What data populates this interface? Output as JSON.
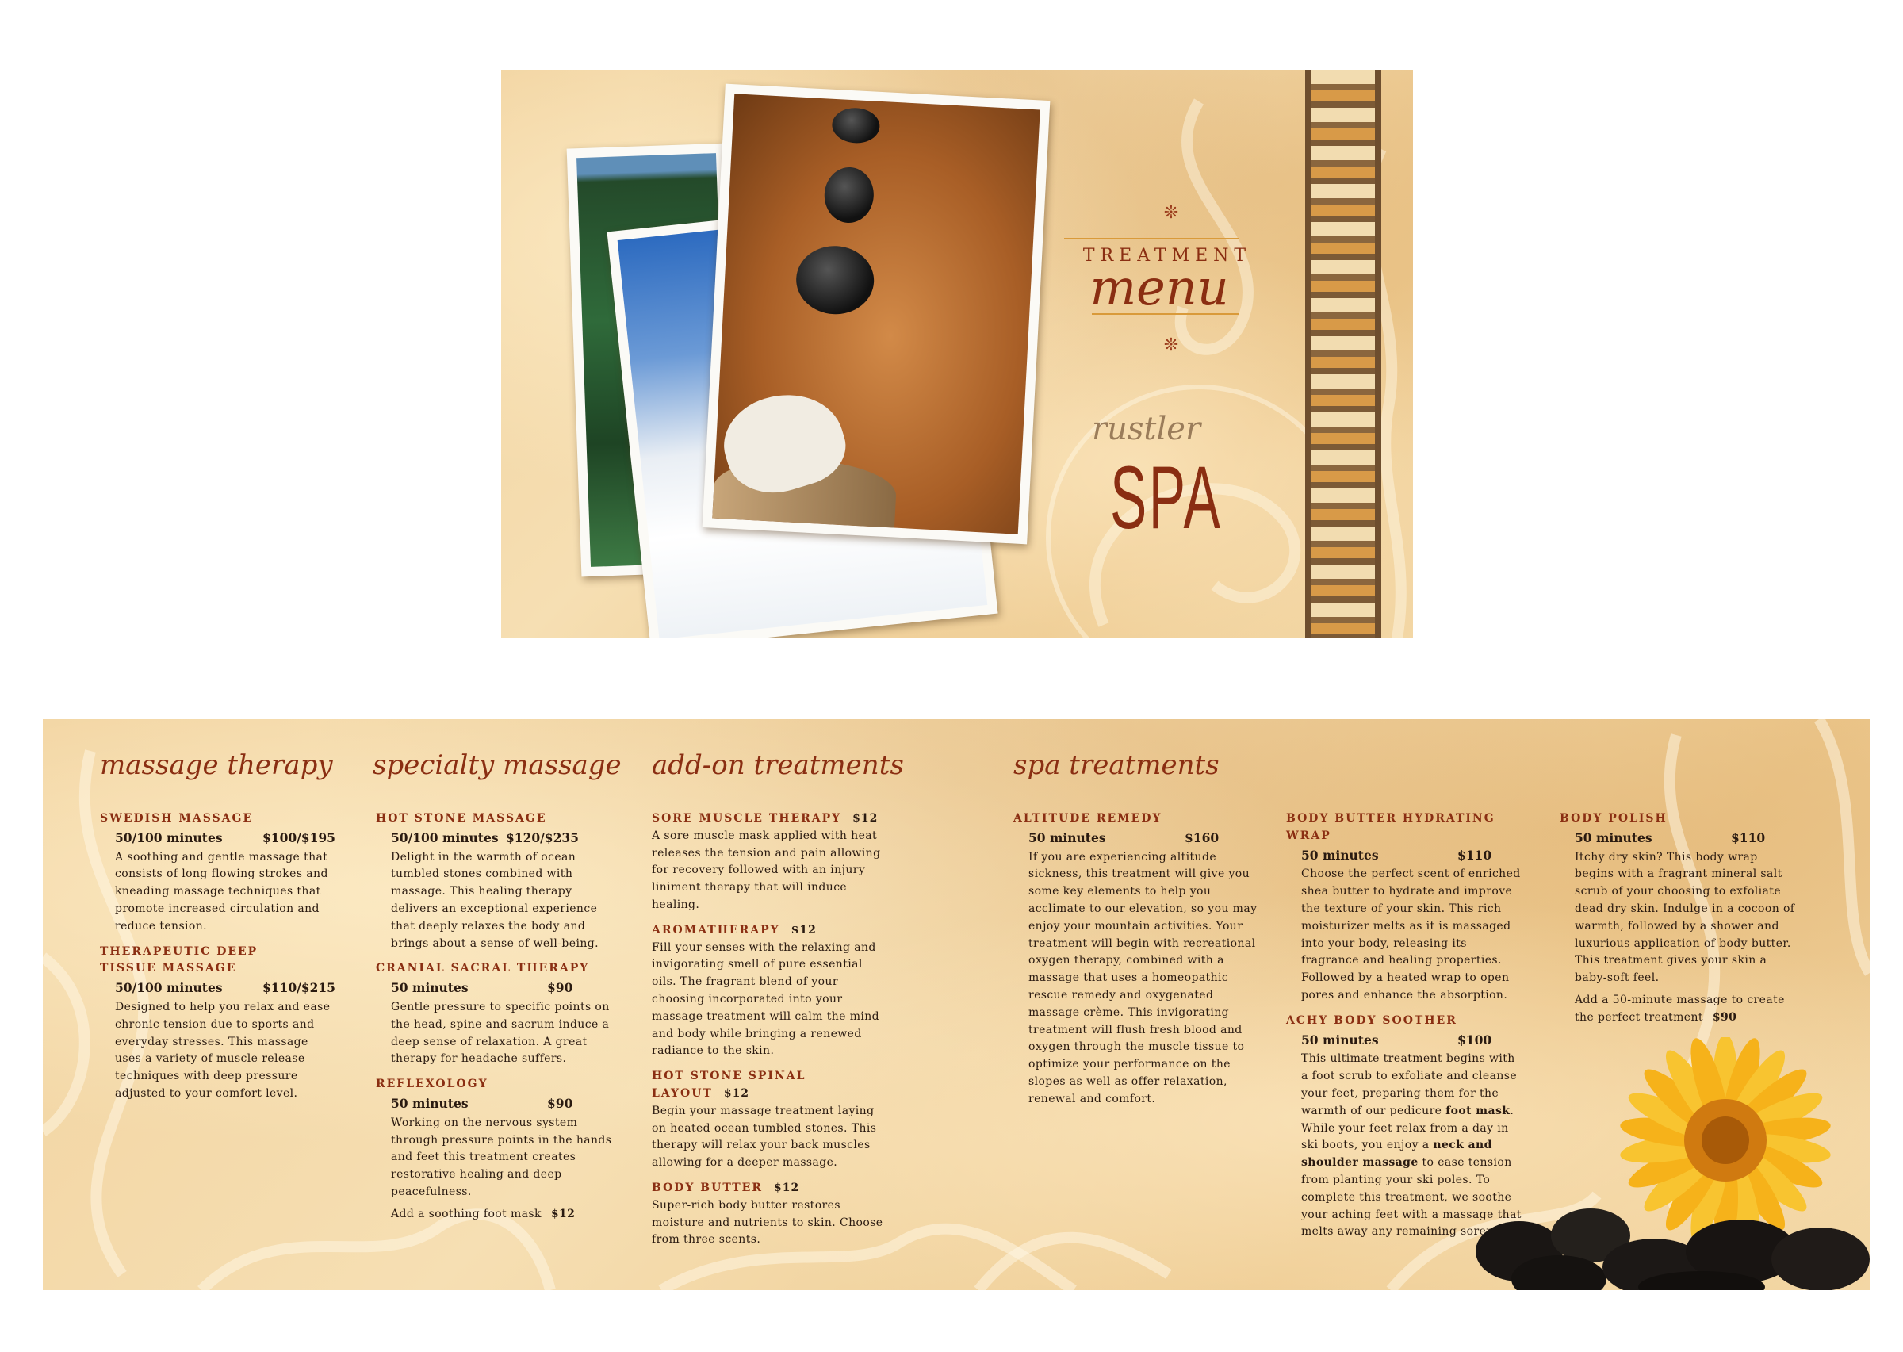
{
  "cover": {
    "title_top": "TREATMENT",
    "title_script": "menu",
    "ornament": "❊",
    "logo_script": "rustler",
    "logo_main": "SPA"
  },
  "colors": {
    "accent": "#8a2e12",
    "parchment": "#f3d7a5",
    "rule": "#d99a3a"
  },
  "sections": [
    {
      "title": "massage therapy",
      "items": [
        {
          "name": "SWEDISH MASSAGE",
          "duration": "50/100 minutes",
          "price": "$100/$195",
          "description": "A soothing and gentle massage that consists of long flowing strokes and kneading massage techniques that promote increased circulation and reduce tension."
        },
        {
          "name": "THERAPEUTIC DEEP TISSUE MASSAGE",
          "duration": "50/100 minutes",
          "price": "$110/$215",
          "description": "Designed to help you relax and ease chronic tension due to sports and everyday stresses. This massage uses a variety of muscle release techniques with deep pressure adjusted to your comfort level."
        }
      ]
    },
    {
      "title": "specialty massage",
      "items": [
        {
          "name": "HOT STONE MASSAGE",
          "duration": "50/100 minutes",
          "price": "$120/$235",
          "description": "Delight in the warmth of ocean tumbled stones combined with massage. This healing therapy delivers an exceptional experience that deeply relaxes the body and brings about a sense of well-being."
        },
        {
          "name": "CRANIAL SACRAL THERAPY",
          "duration": "50 minutes",
          "price": "$90",
          "description": "Gentle pressure to specific points on the head, spine and sacrum induce a deep sense of relaxation. A great therapy for headache suffers."
        },
        {
          "name": "REFLEXOLOGY",
          "duration": "50 minutes",
          "price": "$90",
          "description": "Working on the nervous system through pressure points in the hands and feet this treatment creates restorative healing and deep peacefulness.",
          "addon": "Add a soothing foot mask",
          "addon_price": "$12"
        }
      ]
    },
    {
      "title": "add-on treatments",
      "items": [
        {
          "name": "SORE MUSCLE THERAPY",
          "price": "$12",
          "description": "A sore muscle mask applied with heat releases the tension and pain allowing for recovery followed with an injury liniment therapy that will induce healing."
        },
        {
          "name": "AROMATHERAPY",
          "price": "$12",
          "description": "Fill your senses with the relaxing and invigorating smell of pure essential oils. The fragrant blend of your choosing incorporated into your massage treatment will calm the mind and body while bringing a renewed radiance to the skin."
        },
        {
          "name": "HOT STONE SPINAL LAYOUT",
          "price": "$12",
          "description": "Begin your massage treatment laying on heated ocean tumbled stones. This therapy will relax your back muscles allowing for a deeper massage."
        },
        {
          "name": "BODY BUTTER",
          "price": "$12",
          "description": "Super-rich body butter restores moisture and nutrients to skin. Choose from three scents."
        }
      ]
    },
    {
      "title": "spa treatments",
      "items": [
        {
          "name": "ALTITUDE REMEDY",
          "duration": "50 minutes",
          "price": "$160",
          "description": "If you are experiencing altitude sickness, this treatment will give you some key elements to help you acclimate to our elevation, so you may enjoy your mountain activities. Your treatment will begin with recreational oxygen therapy, combined with a massage that uses a homeopathic rescue remedy and oxygenated massage crème. This invigorating treatment will flush fresh blood and oxygen through the muscle tissue to optimize your performance on the slopes as well as offer relaxation, renewal and comfort."
        }
      ]
    },
    {
      "title": "",
      "items": [
        {
          "name": "BODY BUTTER HYDRATING WRAP",
          "duration": "50 minutes",
          "price": "$110",
          "description": "Choose the perfect scent of enriched shea butter to hydrate and improve the texture of your skin. This rich moisturizer melts as it is massaged into your body, releasing its fragrance and healing properties. Followed by a heated wrap to open pores and enhance the absorption."
        },
        {
          "name": "ACHY BODY SOOTHER",
          "duration": "50 minutes",
          "price": "$100",
          "description_parts": [
            {
              "text": "This ultimate treatment begins with a foot scrub to exfoliate and cleanse your feet, preparing them for the warmth of our pedicure "
            },
            {
              "text": "foot mask",
              "bold": true
            },
            {
              "text": ". While your feet relax from a day in ski boots, you enjoy a "
            },
            {
              "text": "neck and shoulder massage",
              "bold": true
            },
            {
              "text": " to ease tension from planting your ski poles. To complete this treatment, we soothe your aching feet with a massage that melts away any remaining soreness."
            }
          ]
        }
      ]
    },
    {
      "title": "",
      "items": [
        {
          "name": "BODY POLISH",
          "duration": "50 minutes",
          "price": "$110",
          "description": "Itchy dry skin? This body wrap begins with a fragrant mineral salt scrub of your choosing to exfoliate dead dry skin. Indulge in a cocoon of warmth, followed by a shower and luxurious application of body butter. This treatment gives your skin a baby-soft feel.",
          "addon": "Add a 50-minute massage to create the perfect treatment",
          "addon_price": "$90"
        }
      ]
    }
  ]
}
